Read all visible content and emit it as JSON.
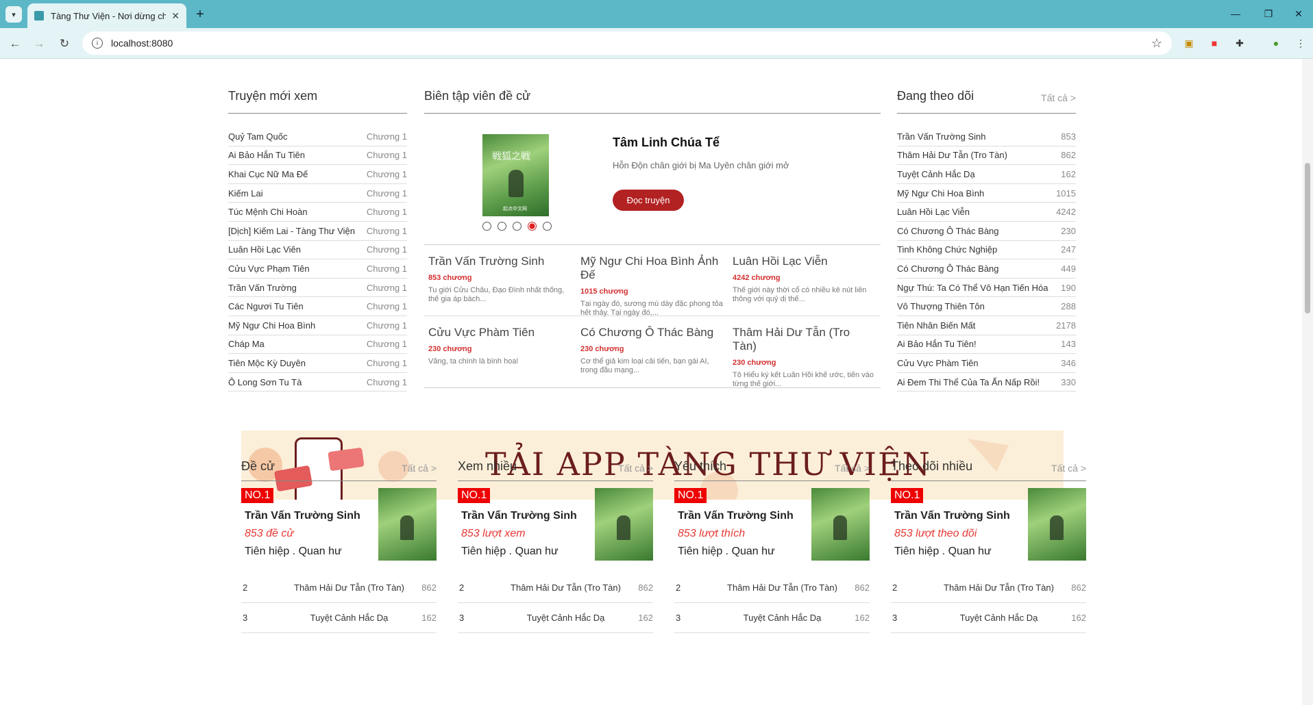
{
  "browser": {
    "tab_title": "Tàng Thư Viện - Nơi dừng chân",
    "url": "localhost:8080"
  },
  "recent": {
    "title": "Truyện mới xem",
    "items": [
      {
        "name": "Quỷ Tam Quốc",
        "chapter": "Chương 1"
      },
      {
        "name": "Ai Bảo Hắn Tu Tiên",
        "chapter": "Chương 1"
      },
      {
        "name": "Khai Cục Nữ Ma Đế",
        "chapter": "Chương 1"
      },
      {
        "name": "Kiếm Lai",
        "chapter": "Chương 1"
      },
      {
        "name": "Túc Mệnh Chi Hoàn",
        "chapter": "Chương 1"
      },
      {
        "name": "[Dịch] Kiếm Lai - Tàng Thư Viện",
        "chapter": "Chương 1"
      },
      {
        "name": "Luân Hồi Lạc Viên",
        "chapter": "Chương 1"
      },
      {
        "name": "Cửu Vực Phạm Tiên",
        "chapter": "Chương 1"
      },
      {
        "name": "Trần Vấn Trường",
        "chapter": "Chương 1"
      },
      {
        "name": "Các Ngươi Tu Tiên",
        "chapter": "Chương 1"
      },
      {
        "name": "Mỹ Ngư Chi Hoa Bình",
        "chapter": "Chương 1"
      },
      {
        "name": "Cháp Ma",
        "chapter": "Chương 1"
      },
      {
        "name": "Tiên Mộc Kỳ Duyên",
        "chapter": "Chương 1"
      },
      {
        "name": "Ô Long Sơn Tu Tà",
        "chapter": "Chương 1"
      }
    ]
  },
  "editor": {
    "title": "Biên tập viên đề cử",
    "featured": {
      "title": "Tâm Linh Chúa Tể",
      "desc": "Hỗn Độn chân giới bị Ma Uyên chân giới mở",
      "read_label": "Đọc truyện",
      "cover_text": "戦狐之戦",
      "cover_pub": "起点中文网"
    },
    "grid": [
      {
        "title": "Trần Vấn Trường Sinh",
        "chapters": "853 chương",
        "desc": "Tu giới Cửu Châu, Đạo Đình nhất thống, thế gia áp bách..."
      },
      {
        "title": "Mỹ Ngư Chi Hoa Bình Ảnh Đế",
        "chapters": "1015 chương",
        "desc": "Tại ngày đó, sương mù dày đặc phong tỏa hết thảy. Tại ngày đó,..."
      },
      {
        "title": "Luân Hồi Lạc Viễn",
        "chapters": "4242 chương",
        "desc": "Thế giới này thời cổ có nhiều kẻ nút liên thông với quỷ dị thế..."
      },
      {
        "title": "Cửu Vực Phàm Tiên",
        "chapters": "230 chương",
        "desc": "Vâng, ta chính là bình hoa!"
      },
      {
        "title": "Có Chương Ô Thác Bàng",
        "chapters": "230 chương",
        "desc": "Cơ thể giả kim loại cải tiến, bạn gái AI, trong đầu mạng..."
      },
      {
        "title": "Thâm Hải Dư Tẫn (Tro Tàn)",
        "chapters": "230 chương",
        "desc": "Tô Hiểu ký kết Luân Hồi khế ước, tiến vào từng thế giới..."
      }
    ]
  },
  "following": {
    "title": "Đang theo dõi",
    "all_label": "Tất cả >",
    "items": [
      {
        "name": "Trần Vấn Trường Sinh",
        "count": "853"
      },
      {
        "name": "Thâm Hải Dư Tẫn (Tro Tàn)",
        "count": "862"
      },
      {
        "name": "Tuyệt Cảnh Hắc Dạ",
        "count": "162"
      },
      {
        "name": "Mỹ Ngư Chi Hoa Bình",
        "count": "1015"
      },
      {
        "name": "Luân Hồi Lạc Viễn",
        "count": "4242"
      },
      {
        "name": "Có Chương Ô Thác Bàng",
        "count": "230"
      },
      {
        "name": "Tinh Không Chức Nghiệp",
        "count": "247"
      },
      {
        "name": "Có Chương Ô Thác Bàng",
        "count": "449"
      },
      {
        "name": "Ngự Thú: Ta Có Thể Vô Hạn Tiến Hóa",
        "count": "190"
      },
      {
        "name": "Vô Thượng Thiên Tôn",
        "count": "288"
      },
      {
        "name": "Tiên Nhân Biến Mất",
        "count": "2178"
      },
      {
        "name": "Ai Bảo Hắn Tu Tiên!",
        "count": "143"
      },
      {
        "name": "Cửu Vực Phàm Tiên",
        "count": "346"
      },
      {
        "name": "Ai Đem Thi Thể Của Ta Ấn Nấp Rồi!",
        "count": "330"
      }
    ]
  },
  "banner": {
    "text": "TẢI APP TÀNG THƯ VIỆN"
  },
  "rankings": [
    {
      "title": "Đề cử",
      "all_label": "Tất cả >",
      "no": "NO.1",
      "name": "Trần Vấn Trường Sinh",
      "stat": "853 đề cử",
      "genre": "Tiên hiệp . Quan hư",
      "rows": [
        {
          "i": "2",
          "name": "Thâm Hải Dư Tẫn (Tro Tàn)",
          "v": "862"
        },
        {
          "i": "3",
          "name": "Tuyệt Cảnh Hắc Dạ",
          "v": "162"
        }
      ]
    },
    {
      "title": "Xem nhiều",
      "all_label": "Tất cả >",
      "no": "NO.1",
      "name": "Trần Vấn Trường Sinh",
      "stat": "853 lượt xem",
      "genre": "Tiên hiệp . Quan hư",
      "rows": [
        {
          "i": "2",
          "name": "Thâm Hải Dư Tẫn (Tro Tàn)",
          "v": "862"
        },
        {
          "i": "3",
          "name": "Tuyệt Cảnh Hắc Dạ",
          "v": "162"
        }
      ]
    },
    {
      "title": "Yêu thích",
      "all_label": "Tất cả >",
      "no": "NO.1",
      "name": "Trần Vấn Trường Sinh",
      "stat": "853 lượt thích",
      "genre": "Tiên hiệp . Quan hư",
      "rows": [
        {
          "i": "2",
          "name": "Thâm Hải Dư Tẫn (Tro Tàn)",
          "v": "862"
        },
        {
          "i": "3",
          "name": "Tuyệt Cảnh Hắc Dạ",
          "v": "162"
        }
      ]
    },
    {
      "title": "Theo dõi nhiều",
      "all_label": "Tất cả >",
      "no": "NO.1",
      "name": "Trần Vấn Trường Sinh",
      "stat": "853 lượt theo dõi",
      "genre": "Tiên hiệp . Quan hư",
      "rows": [
        {
          "i": "2",
          "name": "Thâm Hải Dư Tẫn (Tro Tàn)",
          "v": "862"
        },
        {
          "i": "3",
          "name": "Tuyệt Cảnh Hắc Dạ",
          "v": "162"
        }
      ]
    }
  ]
}
